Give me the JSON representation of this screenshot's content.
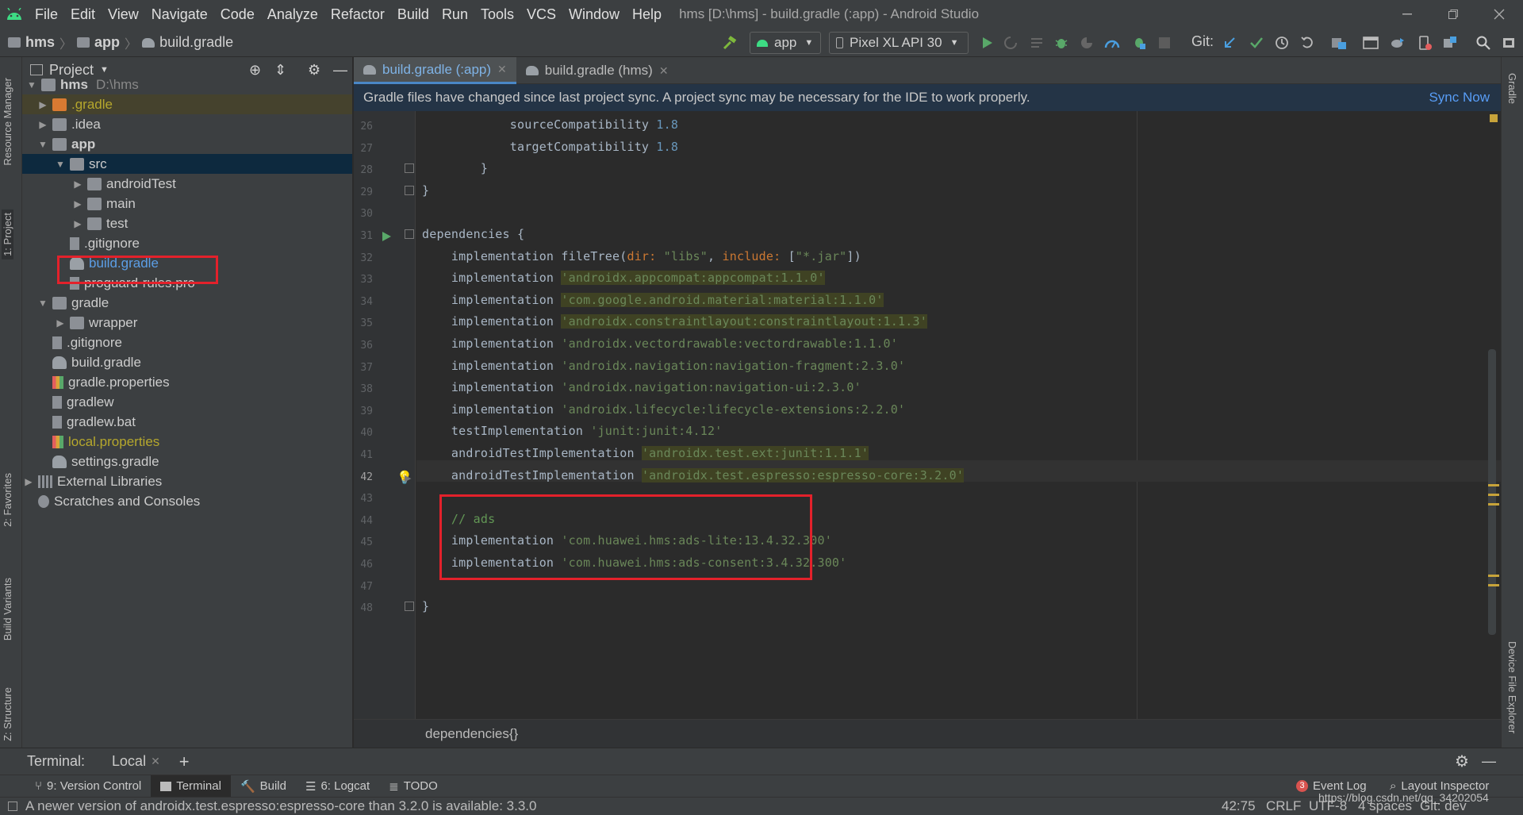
{
  "menu": [
    "File",
    "Edit",
    "View",
    "Navigate",
    "Code",
    "Analyze",
    "Refactor",
    "Build",
    "Run",
    "Tools",
    "VCS",
    "Window",
    "Help"
  ],
  "window_title": "hms [D:\\hms] - build.gradle (:app) - Android Studio",
  "breadcrumb": {
    "root": "hms",
    "module": "app",
    "file": "build.gradle"
  },
  "toolbar": {
    "config": "app",
    "device": "Pixel XL API 30",
    "git_label": "Git:"
  },
  "project_panel": {
    "title": "Project",
    "rows": [
      {
        "label": "hms",
        "extra": "D:\\hms"
      },
      {
        "label": ".gradle"
      },
      {
        "label": ".idea"
      },
      {
        "label": "app"
      },
      {
        "label": "src"
      },
      {
        "label": "androidTest"
      },
      {
        "label": "main"
      },
      {
        "label": "test"
      },
      {
        "label": ".gitignore"
      },
      {
        "label": "build.gradle"
      },
      {
        "label": "proguard-rules.pro"
      },
      {
        "label": "gradle"
      },
      {
        "label": "wrapper"
      },
      {
        "label": ".gitignore"
      },
      {
        "label": "build.gradle"
      },
      {
        "label": "gradle.properties"
      },
      {
        "label": "gradlew"
      },
      {
        "label": "gradlew.bat"
      },
      {
        "label": "local.properties"
      },
      {
        "label": "settings.gradle"
      },
      {
        "label": "External Libraries"
      },
      {
        "label": "Scratches and Consoles"
      }
    ]
  },
  "side_tabs": {
    "resource_manager": "Resource Manager",
    "project": "1: Project",
    "favorites": "2: Favorites",
    "build_variants": "Build Variants",
    "structure": "Z: Structure",
    "gradle": "Gradle",
    "device_file_explorer": "Device File Explorer"
  },
  "tabs": [
    {
      "label": "build.gradle (:app)"
    },
    {
      "label": "build.gradle (hms)"
    }
  ],
  "notification": {
    "text": "Gradle files have changed since last project sync. A project sync may be necessary for the IDE to work properly.",
    "action": "Sync Now"
  },
  "code": {
    "lines": [
      "26",
      "27",
      "28",
      "29",
      "30",
      "31",
      "32",
      "33",
      "34",
      "35",
      "36",
      "37",
      "38",
      "39",
      "40",
      "41",
      "42",
      "43",
      "44",
      "45",
      "46",
      "47",
      "48"
    ],
    "l26a": "            sourceCompatibility ",
    "l26b": "1.8",
    "l27a": "            targetCompatibility ",
    "l27b": "1.8",
    "l28": "        }",
    "l29": "}",
    "l31": "dependencies {",
    "l32a": "    implementation fileTree(",
    "l32b": "dir: ",
    "l32c": "\"libs\"",
    "l32d": ", ",
    "l32e": "include: ",
    "l32f": "[",
    "l32g": "\"*.jar\"",
    "l32h": "])",
    "impl": "    implementation ",
    "l33": "'androidx.appcompat:appcompat:1.1.0'",
    "l34": "'com.google.android.material:material:1.1.0'",
    "l35": "'androidx.constraintlayout:constraintlayout:1.1.3'",
    "l36": "'androidx.vectordrawable:vectordrawable:1.1.0'",
    "l37": "'androidx.navigation:navigation-fragment:2.3.0'",
    "l38": "'androidx.navigation:navigation-ui:2.3.0'",
    "l39": "'androidx.lifecycle:lifecycle-extensions:2.2.0'",
    "l40a": "    testImplementation ",
    "l40b": "'junit:junit:4.12'",
    "l41a": "    androidTestImplementation ",
    "l41b": "'androidx.test.ext:junit:1.1.1'",
    "l42a": "    androidTestImplementation ",
    "l42b": "'androidx.test.espresso:espresso-core:3.2.0'",
    "l44": "    // ads",
    "l45": "'com.huawei.hms:ads-lite:13.4.32.300'",
    "l46": "'com.huawei.hms:ads-consent:3.4.32.300'",
    "l48": "}"
  },
  "editor_breadcrumb": "dependencies{}",
  "terminal": {
    "label": "Terminal:",
    "tab": "Local"
  },
  "tool_windows": [
    "9: Version Control",
    "Terminal",
    "Build",
    "6: Logcat",
    "TODO"
  ],
  "tool_windows_right": {
    "event_log": "Event Log",
    "event_count": "3",
    "layout_inspector": "Layout Inspector"
  },
  "status": {
    "message": "A newer version of androidx.test.espresso:espresso-core than 3.2.0 is available: 3.3.0",
    "position": "42:75",
    "line_sep": "CRLF",
    "encoding": "UTF-8",
    "indent": "4 spaces",
    "git": "Git: dev",
    "watermark": "https://blog.csdn.net/qq_34202054"
  }
}
